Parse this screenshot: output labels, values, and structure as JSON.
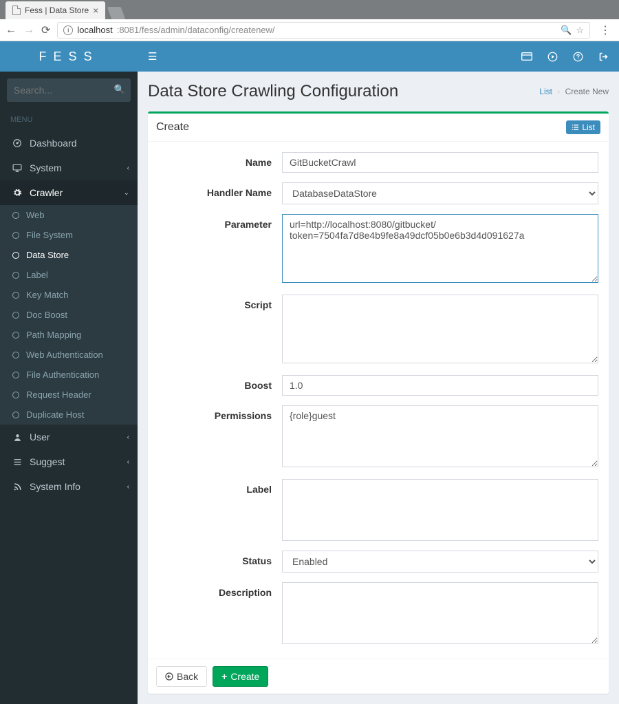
{
  "browser": {
    "tab_title": "Fess | Data Store",
    "url_host": "localhost",
    "url_port_path": ":8081/fess/admin/dataconfig/createnew/"
  },
  "logo": "FESS",
  "search_placeholder": "Search...",
  "menu_header": "MENU",
  "nav": {
    "dashboard": "Dashboard",
    "system": "System",
    "crawler": "Crawler",
    "user": "User",
    "suggest": "Suggest",
    "system_info": "System Info"
  },
  "crawler_sub": {
    "web": "Web",
    "file_system": "File System",
    "data_store": "Data Store",
    "label": "Label",
    "key_match": "Key Match",
    "doc_boost": "Doc Boost",
    "path_mapping": "Path Mapping",
    "web_auth": "Web Authentication",
    "file_auth": "File Authentication",
    "request_header": "Request Header",
    "duplicate_host": "Duplicate Host"
  },
  "page_title": "Data Store Crawling Configuration",
  "breadcrumb": {
    "list": "List",
    "current": "Create New"
  },
  "box_title": "Create",
  "btn_list": "List",
  "form": {
    "name_label": "Name",
    "name_value": "GitBucketCrawl",
    "handler_label": "Handler Name",
    "handler_value": "DatabaseDataStore",
    "parameter_label": "Parameter",
    "parameter_value": "url=http://localhost:8080/gitbucket/\ntoken=7504fa7d8e4b9fe8a49dcf05b0e6b3d4d091627a",
    "script_label": "Script",
    "script_value": "",
    "boost_label": "Boost",
    "boost_value": "1.0",
    "permissions_label": "Permissions",
    "permissions_value": "{role}guest",
    "list_label": "Label",
    "status_label": "Status",
    "status_value": "Enabled",
    "description_label": "Description",
    "description_value": ""
  },
  "btn_back": "Back",
  "btn_create": "Create"
}
